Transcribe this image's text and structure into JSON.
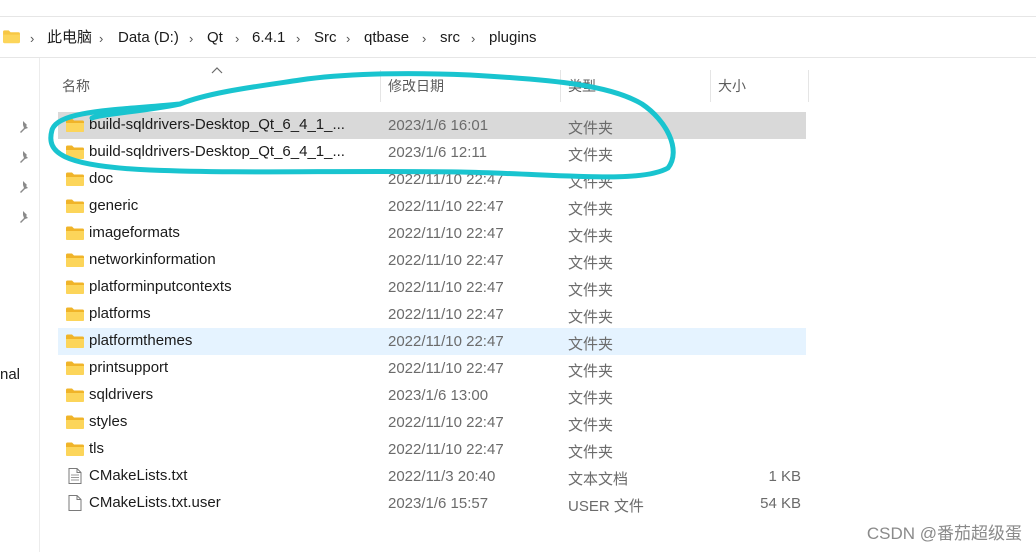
{
  "breadcrumb": [
    "此电脑",
    "Data (D:)",
    "Qt",
    "6.4.1",
    "Src",
    "qtbase",
    "src",
    "plugins"
  ],
  "columns": {
    "name": "名称",
    "date": "修改日期",
    "type": "类型",
    "size": "大小"
  },
  "nav": {
    "partial_text": "nal"
  },
  "rows": [
    {
      "name": "build-sqldrivers-Desktop_Qt_6_4_1_...",
      "date": "2023/1/6 16:01",
      "type": "文件夹",
      "size": "",
      "icon": "folder-icon",
      "state": "selected"
    },
    {
      "name": "build-sqldrivers-Desktop_Qt_6_4_1_...",
      "date": "2023/1/6 12:11",
      "type": "文件夹",
      "size": "",
      "icon": "folder-icon",
      "state": ""
    },
    {
      "name": "doc",
      "date": "2022/11/10 22:47",
      "type": "文件夹",
      "size": "",
      "icon": "folder-icon",
      "state": ""
    },
    {
      "name": "generic",
      "date": "2022/11/10 22:47",
      "type": "文件夹",
      "size": "",
      "icon": "folder-icon",
      "state": ""
    },
    {
      "name": "imageformats",
      "date": "2022/11/10 22:47",
      "type": "文件夹",
      "size": "",
      "icon": "folder-icon",
      "state": ""
    },
    {
      "name": "networkinformation",
      "date": "2022/11/10 22:47",
      "type": "文件夹",
      "size": "",
      "icon": "folder-icon",
      "state": ""
    },
    {
      "name": "platforminputcontexts",
      "date": "2022/11/10 22:47",
      "type": "文件夹",
      "size": "",
      "icon": "folder-icon",
      "state": ""
    },
    {
      "name": "platforms",
      "date": "2022/11/10 22:47",
      "type": "文件夹",
      "size": "",
      "icon": "folder-icon",
      "state": ""
    },
    {
      "name": "platformthemes",
      "date": "2022/11/10 22:47",
      "type": "文件夹",
      "size": "",
      "icon": "folder-icon",
      "state": "hover"
    },
    {
      "name": "printsupport",
      "date": "2022/11/10 22:47",
      "type": "文件夹",
      "size": "",
      "icon": "folder-icon",
      "state": ""
    },
    {
      "name": "sqldrivers",
      "date": "2023/1/6 13:00",
      "type": "文件夹",
      "size": "",
      "icon": "folder-icon",
      "state": ""
    },
    {
      "name": "styles",
      "date": "2022/11/10 22:47",
      "type": "文件夹",
      "size": "",
      "icon": "folder-icon",
      "state": ""
    },
    {
      "name": "tls",
      "date": "2022/11/10 22:47",
      "type": "文件夹",
      "size": "",
      "icon": "folder-icon",
      "state": ""
    },
    {
      "name": "CMakeLists.txt",
      "date": "2022/11/3 20:40",
      "type": "文本文档",
      "size": "1 KB",
      "icon": "text-file-icon",
      "state": ""
    },
    {
      "name": "CMakeLists.txt.user",
      "date": "2023/1/6 15:57",
      "type": "USER 文件",
      "size": "54 KB",
      "icon": "file-icon",
      "state": ""
    }
  ],
  "annotation_color": "#19c4cf",
  "watermark": "CSDN @番茄超级蛋"
}
